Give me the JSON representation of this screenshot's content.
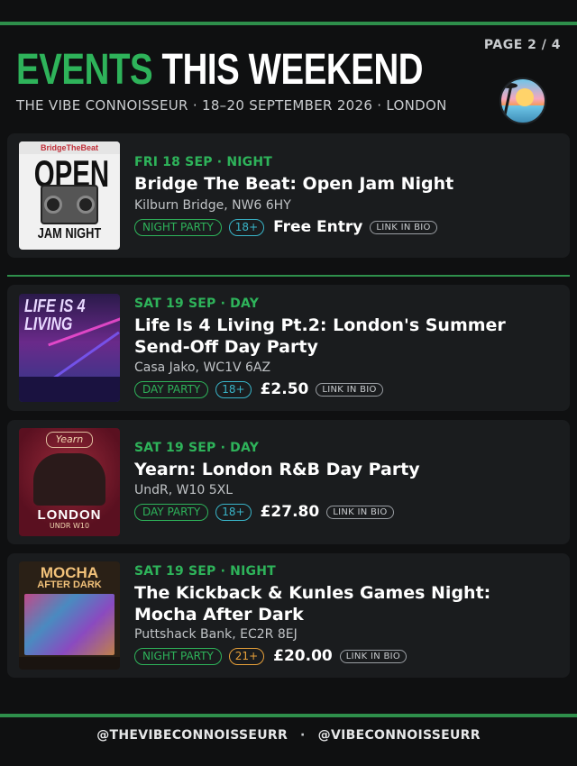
{
  "header": {
    "title_green": "EVENTS",
    "title_white": "THIS WEEKEND",
    "subtitle": "THE VIBE CONNOISSEUR · 18–20 SEPTEMBER 2026 · LONDON",
    "page": "PAGE 2 / 4",
    "logo_icon": "palm-sunset-logo"
  },
  "colors": {
    "accent": "#2eb35a",
    "background": "#0f1011",
    "card": "#1a1c1e",
    "age_teal": "#39b5c9",
    "age_orange": "#e8a13a"
  },
  "events": [
    {
      "date": "FRI 18 SEP · NIGHT",
      "title": "Bridge The Beat: Open Jam Night",
      "venue": "Kilburn Bridge, NW6 6HY",
      "type": "NIGHT PARTY",
      "age": "18+",
      "price": "Free Entry",
      "link": "LINK IN BIO",
      "poster": {
        "top": "BridgeTheBeat",
        "big": "OPEN",
        "bottom": "JAM NIGHT"
      }
    },
    {
      "date": "SAT 19 SEP · DAY",
      "title": "Life Is 4 Living Pt.2: London's Summer Send-Off Day Party",
      "venue": "Casa Jako, WC1V 6AZ",
      "type": "DAY PARTY",
      "age": "18+",
      "price": "£2.50",
      "link": "LINK IN BIO",
      "poster": {
        "big": "LIFE IS 4 LIVING"
      }
    },
    {
      "date": "SAT 19 SEP · DAY",
      "title": "Yearn: London R&B Day Party",
      "venue": "UndR, W10 5XL",
      "type": "DAY PARTY",
      "age": "18+",
      "price": "£27.80",
      "link": "LINK IN BIO",
      "poster": {
        "top": "Yearn",
        "big": "LONDON",
        "bottom": "UNDR W10"
      }
    },
    {
      "date": "SAT 19 SEP · NIGHT",
      "title": "The Kickback & Kunles Games Night: Mocha After Dark",
      "venue": "Puttshack Bank, EC2R 8EJ",
      "type": "NIGHT PARTY",
      "age": "21+",
      "price": "£20.00",
      "link": "LINK IN BIO",
      "poster": {
        "big": "MOCHA",
        "bottom": "AFTER DARK"
      }
    }
  ],
  "footer": {
    "handle1": "@THEVIBECONNOISSEURR",
    "separator": "·",
    "handle2": "@VIBECONNOISSEURR"
  }
}
